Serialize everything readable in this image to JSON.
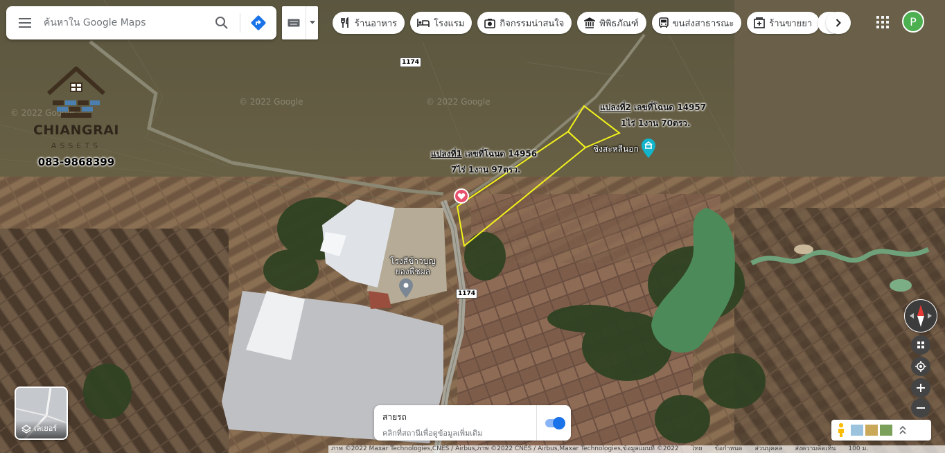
{
  "search": {
    "placeholder": "ค้นหาใน Google Maps"
  },
  "chips": [
    {
      "label": "ร้านอาหาร",
      "icon": "fork-knife-icon"
    },
    {
      "label": "โรงแรม",
      "icon": "bed-icon"
    },
    {
      "label": "กิจกรรมน่าสนใจ",
      "icon": "camera-icon"
    },
    {
      "label": "พิพิธภัณฑ์",
      "icon": "museum-icon"
    },
    {
      "label": "ขนส่งสาธารณะ",
      "icon": "bus-icon"
    },
    {
      "label": "ร้านขายยา",
      "icon": "pharmacy-icon"
    }
  ],
  "account": {
    "initial": "P",
    "color": "#4caf50"
  },
  "logo": {
    "brand": "CHIANGRAI",
    "sub": "ASSETS",
    "phone": "083-9868399"
  },
  "parcels": [
    {
      "title": "แปลงที่1",
      "deed": " เลขที่โฉนด 14956",
      "area": "7ไร่ 1งาน 97ตรว."
    },
    {
      "title": "แปลงที่2",
      "deed": " เลขที่โฉนด 14957",
      "area": "1ไร่ 1งาน 70ตรว."
    }
  ],
  "places": {
    "mill": "โรงสีข้าวบุญ\nยองพืชผล",
    "temple": "ชิงสะหลีนอก"
  },
  "roads": {
    "route": "1174"
  },
  "watermark": "© 2022 Google",
  "traffic": {
    "title": "สายรถ",
    "subtitle": "คลิกที่สถานีเพื่อดูข้อมูลเพิ่มเติม"
  },
  "layers": {
    "label": "เลเยอร์"
  },
  "footer": {
    "attribution": "ภาพ ©2022 Maxar Technologies,CNES / Airbus,ภาพ ©2022 CNES / Airbus,Maxar Technologies,ข้อมูลแผนที่ ©2022",
    "country": "ไทย",
    "terms": "ข้อกำหนด",
    "privacy": "ส่วนบุคคล",
    "feedback": "ส่งความคิดเห็น",
    "scale": "100 ม."
  },
  "colors": {
    "parcel_outline": "#f2f21c",
    "accent": "#1a73e8"
  }
}
